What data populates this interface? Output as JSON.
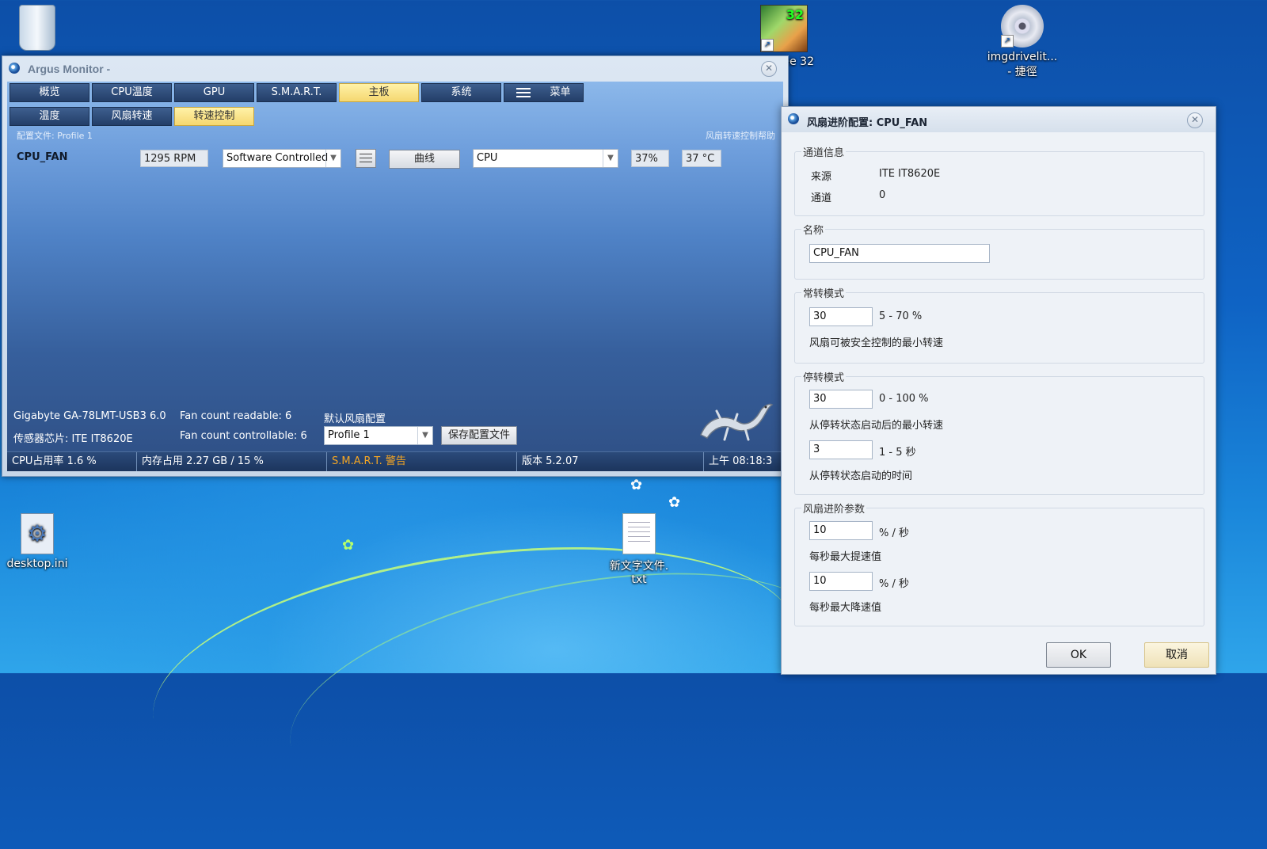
{
  "desktop": {
    "icons": {
      "recycle_bin": "",
      "eyeglass_app": "ee 32",
      "imgdrive_line1": "imgdrivelit...",
      "imgdrive_line2": "- 捷徑",
      "desktop_ini": "desktop.ini",
      "new_text_line1": "新文字文件.",
      "new_text_line2": "txt"
    }
  },
  "main_window": {
    "title": "Argus Monitor -",
    "tabs": [
      "概览",
      "CPU温度",
      "GPU",
      "S.M.A.R.T.",
      "主板",
      "系统",
      "菜单"
    ],
    "active_tab": "主板",
    "subtabs": [
      "温度",
      "风扇转速",
      "转速控制"
    ],
    "active_subtab": "转速控制",
    "profile_label": "配置文件: Profile 1",
    "help_link": "风扇转速控制帮助",
    "fan_row": {
      "name": "CPU_FAN",
      "rpm": "1295 RPM",
      "mode": "Software Controlled",
      "curve_button": "曲线",
      "source": "CPU",
      "percent": "37%",
      "temp": "37 °C"
    },
    "board_info": {
      "board": "Gigabyte GA-78LMT-USB3 6.0",
      "sensor_chip": "传感器芯片: ITE IT8620E",
      "fan_readable": "Fan count readable: 6",
      "fan_controllable": "Fan count controllable: 6",
      "default_profile_label": "默认风扇配置",
      "profile_select": "Profile 1",
      "save_button": "保存配置文件"
    },
    "status_bar": {
      "cpu": "CPU占用率 1.6 %",
      "memory": "内存占用 2.27 GB / 15 %",
      "smart": "S.M.A.R.T. 警告",
      "version": "版本 5.2.07",
      "time": "上午 08:18:3"
    }
  },
  "dialog": {
    "title": "风扇进阶配置: CPU_FAN",
    "channel_info": {
      "group_title": "通道信息",
      "source_label": "来源",
      "source_value": "ITE IT8620E",
      "channel_label": "通道",
      "channel_value": "0"
    },
    "name_group": {
      "group_title": "名称",
      "value": "CPU_FAN"
    },
    "constant_mode": {
      "group_title": "常转模式",
      "value": "30",
      "range": "5 - 70 %",
      "desc": "风扇可被安全控制的最小转速"
    },
    "stop_mode": {
      "group_title": "停转模式",
      "value1": "30",
      "range1": "0 - 100 %",
      "desc1": "从停转状态启动后的最小转速",
      "value2": "3",
      "range2": "1 - 5 秒",
      "desc2": "从停转状态启动的时间"
    },
    "advanced": {
      "group_title": "风扇进阶参数",
      "value1": "10",
      "unit1": "% / 秒",
      "desc1": "每秒最大提速值",
      "value2": "10",
      "unit2": "% / 秒",
      "desc2": "每秒最大降速值"
    },
    "ok": "OK",
    "cancel": "取消"
  }
}
